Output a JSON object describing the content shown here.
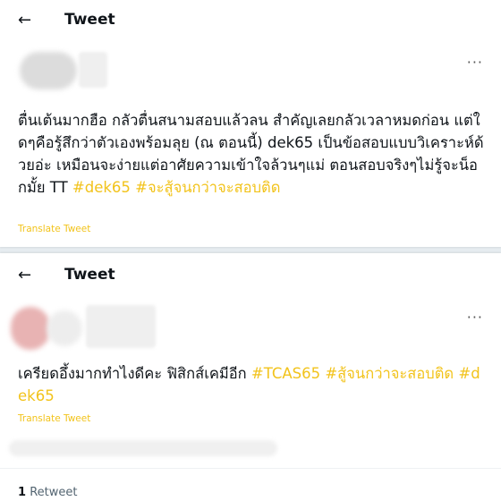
{
  "tweets": [
    {
      "header_title": "Tweet",
      "back_icon": "←",
      "more_icon": "···",
      "text_before": "ตื่นเต้นมากฮือ กลัวตื่นสนามสอบแล้วลน สำคัญเลยกลัวเวลาหมดก่อน แต่ใดๆคือรู้สึกว่าตัวเองพร้อมลุย (ณ ตอนนี้) dek65 เป็นข้อสอบแบบวิเคราะห์ด้วยอ่ะ เหมือนจะง่ายแต่อาศัยความเข้าใจล้วนๆแม่ ตอนสอบจริงๆไม่รู้จะน็อกมั้ย TT ",
      "hashtags": [
        "#dek65",
        "#จะสู้จนกว่าจะสอบติด"
      ],
      "translate_label": "Translate Tweet"
    },
    {
      "header_title": "Tweet",
      "back_icon": "←",
      "more_icon": "···",
      "text_before": "เครียดอึ้งมากทำไงดีคะ ฟิสิกส์เคมีอีก ",
      "hashtags": [
        "#TCAS65",
        "#สู้จนกว่าจะสอบติด",
        "#dek65"
      ],
      "translate_label": "Translate Tweet",
      "retweet_count": "1",
      "retweet_label": "Retweet"
    }
  ],
  "colors": {
    "hashtag": "#f2c31b",
    "text": "#0f1419",
    "secondary": "#536471"
  }
}
